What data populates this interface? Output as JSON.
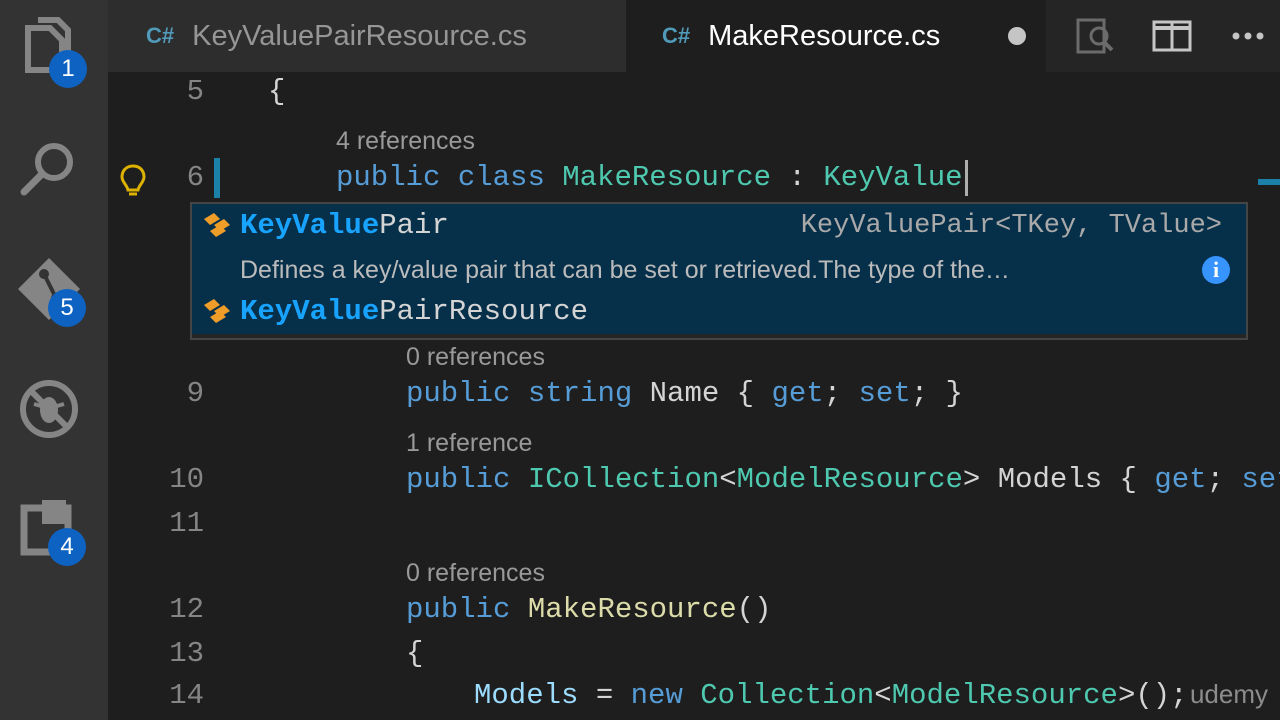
{
  "activity_bar": {
    "explorer_badge": "1",
    "scm_badge": "5",
    "extensions_badge": "4"
  },
  "tabs": [
    {
      "icon": "C#",
      "label": "KeyValuePairResource.cs",
      "active": false
    },
    {
      "icon": "C#",
      "label": "MakeResource.cs",
      "active": true,
      "dirty": true
    }
  ],
  "editor": {
    "lines": [
      {
        "number": "5",
        "text": "{"
      },
      {
        "lens": "4 references"
      },
      {
        "number": "6",
        "tokens": [
          {
            "t": "public",
            "c": "kw"
          },
          {
            "t": " "
          },
          {
            "t": "class",
            "c": "kw"
          },
          {
            "t": " "
          },
          {
            "t": "MakeResource",
            "c": "ty"
          },
          {
            "t": " : "
          },
          {
            "t": "KeyValue",
            "c": "ty"
          }
        ]
      },
      {
        "lens": "0 references"
      },
      {
        "number": "9",
        "tokens": [
          {
            "t": "public",
            "c": "kw"
          },
          {
            "t": " "
          },
          {
            "t": "string",
            "c": "kw"
          },
          {
            "t": " Name { "
          },
          {
            "t": "get",
            "c": "kw"
          },
          {
            "t": "; "
          },
          {
            "t": "set",
            "c": "kw"
          },
          {
            "t": "; }"
          }
        ]
      },
      {
        "lens": "1 reference"
      },
      {
        "number": "10",
        "tokens": [
          {
            "t": "public",
            "c": "kw"
          },
          {
            "t": " "
          },
          {
            "t": "ICollection",
            "c": "ty"
          },
          {
            "t": "<"
          },
          {
            "t": "ModelResource",
            "c": "ty"
          },
          {
            "t": "> Models { "
          },
          {
            "t": "get",
            "c": "kw"
          },
          {
            "t": "; "
          },
          {
            "t": "set",
            "c": "kw"
          }
        ]
      },
      {
        "number": "11",
        "text": ""
      },
      {
        "lens": "0 references"
      },
      {
        "number": "12",
        "tokens": [
          {
            "t": "public",
            "c": "kw"
          },
          {
            "t": " "
          },
          {
            "t": "MakeResource",
            "c": "fn"
          },
          {
            "t": "()"
          }
        ]
      },
      {
        "number": "13",
        "text": "{"
      },
      {
        "number": "14",
        "tokens": [
          {
            "t": "Models",
            "c": "id"
          },
          {
            "t": " = "
          },
          {
            "t": "new",
            "c": "kw"
          },
          {
            "t": " "
          },
          {
            "t": "Collection",
            "c": "ty"
          },
          {
            "t": "<"
          },
          {
            "t": "ModelResource",
            "c": "ty"
          },
          {
            "t": ">();"
          }
        ]
      }
    ]
  },
  "suggest": {
    "items": [
      {
        "match": "KeyValue",
        "rest": "Pair",
        "detail": "KeyValuePair<TKey, TValue>",
        "selected": true,
        "kind": "class-icon"
      },
      {
        "match": "KeyValue",
        "rest": "PairResource",
        "selected": false,
        "kind": "class-icon"
      }
    ],
    "doc": "Defines a key/value pair that can be set or retrieved.The type of the…",
    "info_icon": "i"
  },
  "watermark": "udemy"
}
